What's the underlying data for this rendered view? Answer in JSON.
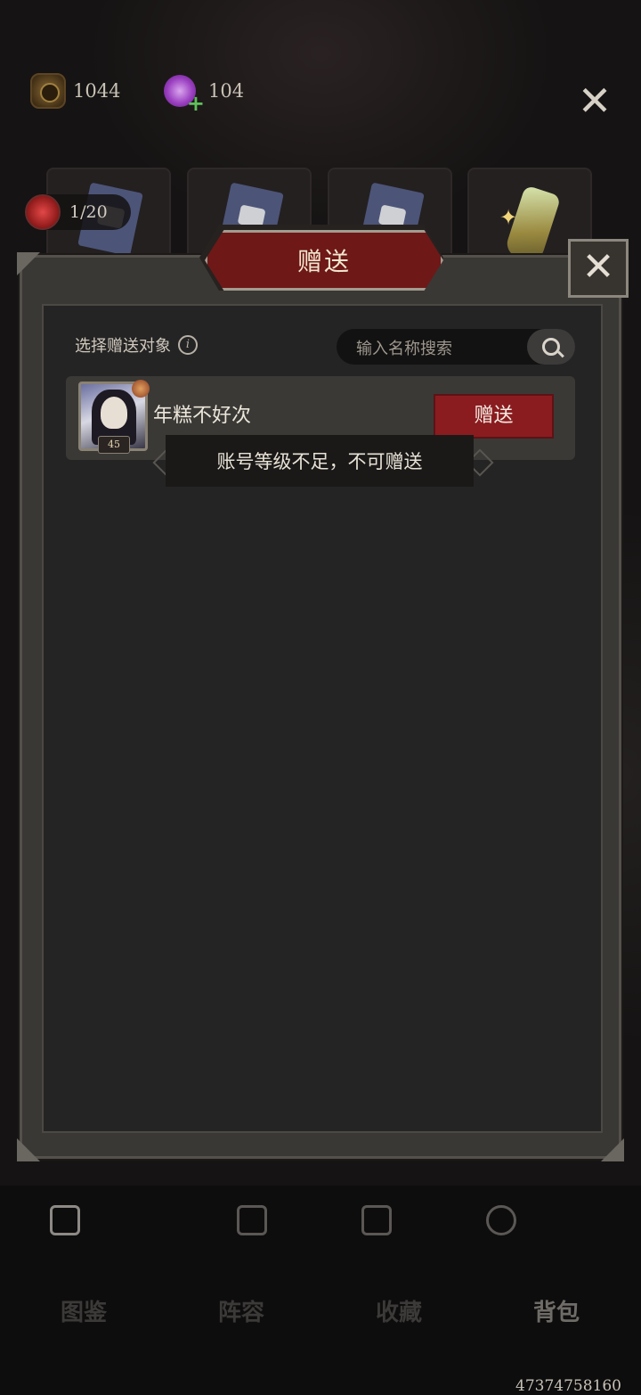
{
  "currency": {
    "pumpkin_icon": "pumpkin-coin-icon",
    "pumpkin_value": "1044",
    "candy_icon": "candy-icon",
    "candy_value": "104",
    "candy_add": "+"
  },
  "top_close_label": "✕",
  "item_counter": "1/20",
  "dialog": {
    "title": "赠送",
    "close_label": "✕",
    "select_label": "选择赠送对象",
    "info_glyph": "i",
    "search_placeholder": "输入名称搜索",
    "friends": [
      {
        "name": "年糕不好次",
        "level": "45",
        "action_label": "赠送"
      }
    ],
    "toast": "账号等级不足，不可赠送"
  },
  "tabs": [
    {
      "label": "图鉴",
      "icon": "grid-icon",
      "active": true
    },
    {
      "label": "阵容",
      "icon": "gift-icon",
      "active": false
    },
    {
      "label": "收藏",
      "icon": "chest-icon",
      "active": false
    },
    {
      "label": "背包",
      "icon": "more-icon",
      "active": true
    }
  ],
  "footer_id": "47374758160",
  "colors": {
    "accent_red": "#8a1c20",
    "banner_red": "#6e1818",
    "background": "#151313"
  }
}
